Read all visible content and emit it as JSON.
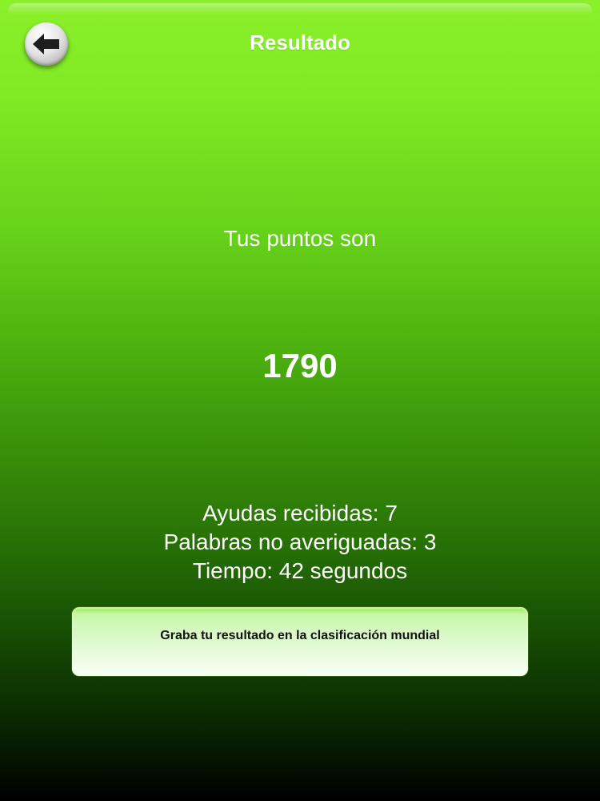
{
  "header": {
    "title": "Resultado",
    "back_icon": "arrow-left-icon"
  },
  "result": {
    "points_label": "Tus puntos son",
    "score": "1790"
  },
  "stats": {
    "hints": "Ayudas recibidas: 7",
    "words_not_guessed": "Palabras no averiguadas: 3",
    "time": "Tiempo: 42 segundos"
  },
  "actions": {
    "save_to_leaderboard_label": "Graba tu resultado en la clasificación mundial"
  },
  "colors": {
    "background_top": "#8af02a",
    "background_bottom": "#000000",
    "text": "#ffffff",
    "button_text": "#111111"
  }
}
